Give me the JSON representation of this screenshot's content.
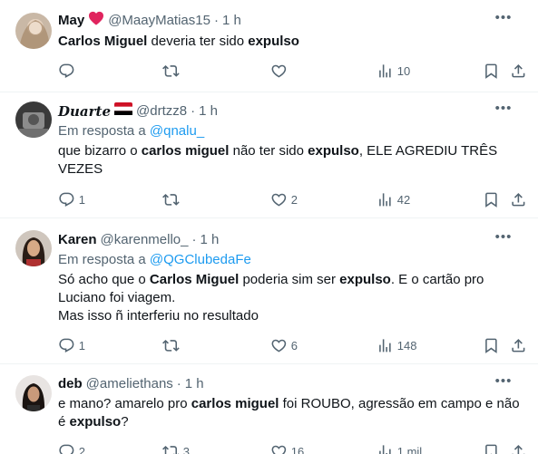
{
  "tweets": [
    {
      "name": "May",
      "handle": "@MaayMatias15",
      "time": "1 h",
      "reply_prefix": "",
      "reply_to": "",
      "text_parts": [
        {
          "t": "Carlos Miguel",
          "b": true
        },
        {
          "t": " deveria ter sido ",
          "b": false
        },
        {
          "t": "expulso",
          "b": true
        }
      ],
      "stats": {
        "replies": "",
        "retweets": "",
        "likes": "",
        "views": "10"
      }
    },
    {
      "name": "Duarte",
      "handle": "@drtzz8",
      "time": "1 h",
      "reply_prefix": "Em resposta a ",
      "reply_to": "@qnalu_",
      "text_parts": [
        {
          "t": "que bizarro o ",
          "b": false
        },
        {
          "t": "carlos miguel",
          "b": true
        },
        {
          "t": " não ter sido ",
          "b": false
        },
        {
          "t": "expulso",
          "b": true
        },
        {
          "t": ", ELE AGREDIU TRÊS VEZES",
          "b": false
        }
      ],
      "stats": {
        "replies": "1",
        "retweets": "",
        "likes": "2",
        "views": "42"
      }
    },
    {
      "name": "Karen",
      "handle": "@karenmello_",
      "time": "1 h",
      "reply_prefix": "Em resposta a ",
      "reply_to": "@QGClubedaFe",
      "text_parts": [
        {
          "t": "Só acho que o ",
          "b": false
        },
        {
          "t": "Carlos Miguel",
          "b": true
        },
        {
          "t": " poderia sim ser ",
          "b": false
        },
        {
          "t": "expulso",
          "b": true
        },
        {
          "t": ". E o cartão pro Luciano foi viagem.",
          "b": false
        },
        {
          "t": "\n",
          "b": false
        },
        {
          "t": "Mas isso ñ interferiu no resultado",
          "b": false
        }
      ],
      "stats": {
        "replies": "1",
        "retweets": "",
        "likes": "6",
        "views": "148"
      }
    },
    {
      "name": "deb",
      "handle": "@ameliethans",
      "time": "1 h",
      "reply_prefix": "",
      "reply_to": "",
      "text_parts": [
        {
          "t": "e mano? amarelo pro ",
          "b": false
        },
        {
          "t": "carlos miguel",
          "b": true
        },
        {
          "t": " foi ROUBO, agressão em campo e não é ",
          "b": false
        },
        {
          "t": "expulso",
          "b": true
        },
        {
          "t": "?",
          "b": false
        }
      ],
      "stats": {
        "replies": "2",
        "retweets": "3",
        "likes": "16",
        "views": "1 mil"
      }
    }
  ],
  "colors": {
    "text": "#0f1419",
    "muted": "#536471",
    "link": "#1d9bf0",
    "heart": "#e0245e",
    "divider": "#eff3f4"
  },
  "icons": [
    "reply-icon",
    "retweet-icon",
    "like-icon",
    "views-icon",
    "bookmark-icon",
    "share-icon",
    "more-icon",
    "heart-emoji-icon",
    "flag-icon"
  ]
}
